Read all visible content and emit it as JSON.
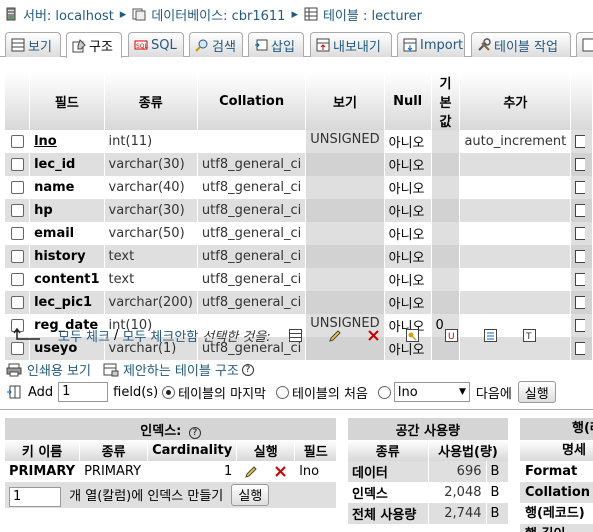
{
  "breadcrumb": {
    "server_label": "서버: localhost",
    "db_label": "데이터베이스: cbr1611",
    "table_label": "테이블 : lecturer"
  },
  "tabs": [
    {
      "label": "보기",
      "icon": "browse-icon"
    },
    {
      "label": "구조",
      "icon": "structure-icon"
    },
    {
      "label": "SQL",
      "icon": "sql-icon"
    },
    {
      "label": "검색",
      "icon": "search-icon"
    },
    {
      "label": "삽입",
      "icon": "insert-icon"
    },
    {
      "label": "내보내기",
      "icon": "export-icon"
    },
    {
      "label": "Import",
      "icon": "import-icon"
    },
    {
      "label": "테이블 작업",
      "icon": "operations-icon"
    }
  ],
  "structure": {
    "headers": [
      "필드",
      "종류",
      "Collation",
      "보기",
      "Null",
      "기본값",
      "추가"
    ],
    "rows": [
      {
        "field": "lno",
        "type": "int(11)",
        "collation": "",
        "attributes": "UNSIGNED",
        "null": "아니오",
        "default": "",
        "extra": "auto_increment",
        "primary": true
      },
      {
        "field": "lec_id",
        "type": "varchar(30)",
        "collation": "utf8_general_ci",
        "attributes": "",
        "null": "아니오",
        "default": "",
        "extra": ""
      },
      {
        "field": "name",
        "type": "varchar(40)",
        "collation": "utf8_general_ci",
        "attributes": "",
        "null": "아니오",
        "default": "",
        "extra": ""
      },
      {
        "field": "hp",
        "type": "varchar(30)",
        "collation": "utf8_general_ci",
        "attributes": "",
        "null": "아니오",
        "default": "",
        "extra": ""
      },
      {
        "field": "email",
        "type": "varchar(50)",
        "collation": "utf8_general_ci",
        "attributes": "",
        "null": "아니오",
        "default": "",
        "extra": ""
      },
      {
        "field": "history",
        "type": "text",
        "collation": "utf8_general_ci",
        "attributes": "",
        "null": "아니오",
        "default": "",
        "extra": ""
      },
      {
        "field": "content1",
        "type": "text",
        "collation": "utf8_general_ci",
        "attributes": "",
        "null": "아니오",
        "default": "",
        "extra": ""
      },
      {
        "field": "lec_pic1",
        "type": "varchar(200)",
        "collation": "utf8_general_ci",
        "attributes": "",
        "null": "아니오",
        "default": "",
        "extra": ""
      },
      {
        "field": "reg_date",
        "type": "int(10)",
        "collation": "",
        "attributes": "UNSIGNED",
        "null": "아니오",
        "default": "0",
        "extra": ""
      },
      {
        "field": "useyo",
        "type": "varchar(1)",
        "collation": "utf8_general_ci",
        "attributes": "",
        "null": "아니오",
        "default": "",
        "extra": ""
      }
    ]
  },
  "row_actions": {
    "check_all": "모두 체크",
    "sep": "/",
    "uncheck_all": "모두 체크안함",
    "with_selected": "선택한 것을:"
  },
  "links": {
    "print_view": "인쇄용 보기",
    "propose_structure": "제안하는 테이블 구조"
  },
  "add_field": {
    "add_label": "Add",
    "count_value": "1",
    "fields_label": "field(s)",
    "at_end": "테이블의 마지막",
    "at_beginning": "테이블의 처음",
    "after_select_value": "lno",
    "after_label": "다음에",
    "execute": "실행"
  },
  "indexes": {
    "title": "인덱스:",
    "headers": [
      "키 이름",
      "종류",
      "Cardinality",
      "실행",
      "필드"
    ],
    "rows": [
      {
        "key_name": "PRIMARY",
        "type": "PRIMARY",
        "cardinality": "1",
        "field": "lno"
      }
    ],
    "create_count": "1",
    "create_label": "개 열(칼럼)에 인덱스 만들기",
    "create_button": "실행"
  },
  "space_usage": {
    "title": "공간 사용량",
    "headers": [
      "종류",
      "사용법(량)"
    ],
    "rows": [
      {
        "label": "데이터",
        "value": "696",
        "unit": "B"
      },
      {
        "label": "인덱스",
        "value": "2,048",
        "unit": "B"
      },
      {
        "label": "전체 사용량",
        "value": "2,744",
        "unit": "B"
      }
    ]
  },
  "row_stats": {
    "title": "행(레",
    "header": "명세",
    "items": [
      "Format",
      "Collation",
      "행(레코드)",
      "행 길이"
    ]
  },
  "colors": {
    "link": "#235a81",
    "row_alt": "#dfdfdf",
    "delete_red": "#cc0000"
  }
}
